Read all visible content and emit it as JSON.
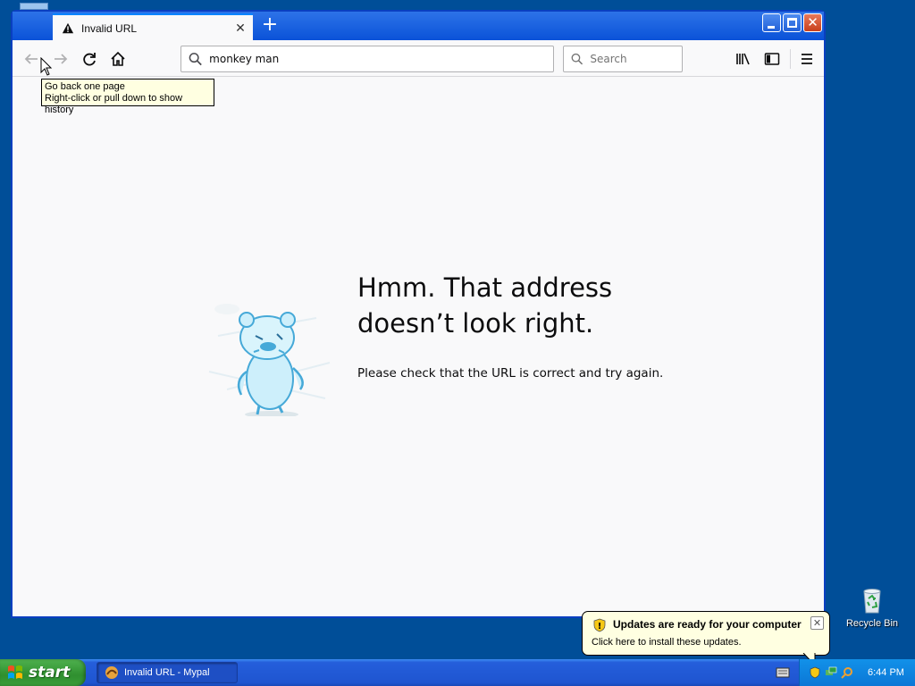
{
  "browser": {
    "tab": {
      "title": "Invalid URL"
    },
    "url": "monkey man",
    "search_placeholder": "Search",
    "tooltip": {
      "line1": "Go back one page",
      "line2": "Right-click or pull down to show history"
    },
    "error": {
      "title": "Hmm. That address doesn’t look right.",
      "description": "Please check that the URL is correct and try again."
    }
  },
  "desktop": {
    "recycle_bin_label": "Recycle Bin"
  },
  "balloon": {
    "title": "Updates are ready for your computer",
    "text": "Click here to install these updates."
  },
  "taskbar": {
    "start_label": "start",
    "task_label": "Invalid URL - Mypal",
    "clock": "6:44 PM"
  },
  "colors": {
    "desktop": "#004e98",
    "accent": "#0a84ff",
    "tooltip_bg": "#ffffe1"
  }
}
